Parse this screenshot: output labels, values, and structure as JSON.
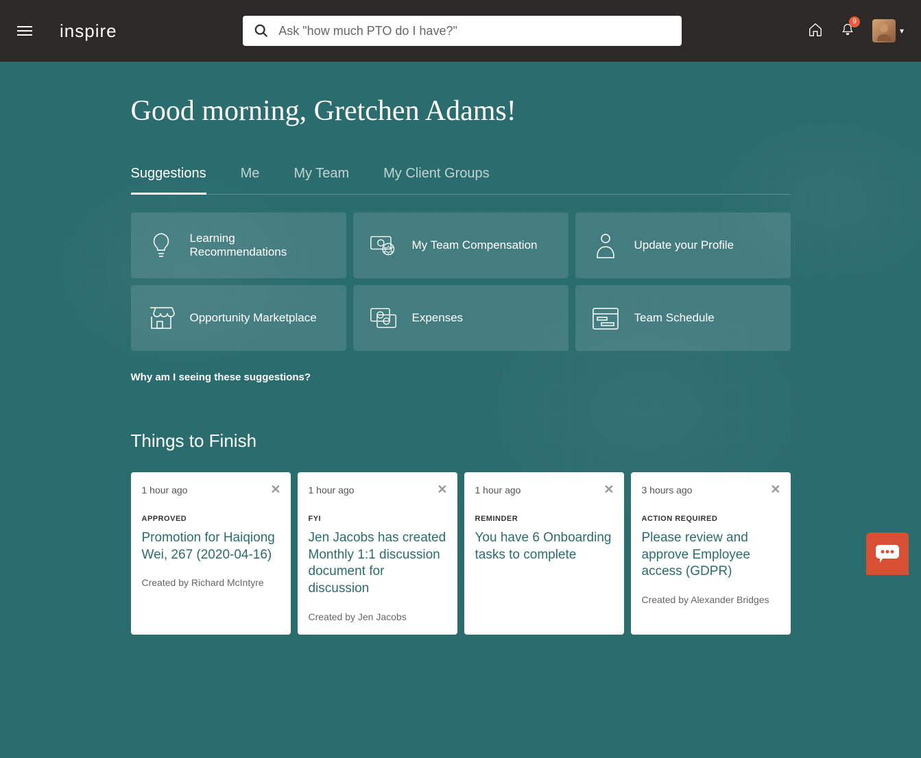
{
  "header": {
    "logo": "inspire",
    "search_placeholder": "Ask \"how much PTO do I have?\"",
    "notification_count": "9"
  },
  "greeting": "Good morning, Gretchen Adams!",
  "tabs": [
    {
      "label": "Suggestions",
      "active": true
    },
    {
      "label": "Me",
      "active": false
    },
    {
      "label": "My Team",
      "active": false
    },
    {
      "label": "My Client Groups",
      "active": false
    }
  ],
  "suggestion_cards": [
    {
      "label": "Learning Recommendations",
      "icon": "lightbulb"
    },
    {
      "label": "My Team Compensation",
      "icon": "compensation"
    },
    {
      "label": "Update your Profile",
      "icon": "profile"
    },
    {
      "label": "Opportunity Marketplace",
      "icon": "marketplace"
    },
    {
      "label": "Expenses",
      "icon": "expenses"
    },
    {
      "label": "Team Schedule",
      "icon": "schedule"
    }
  ],
  "suggestions_link": "Why am I seeing these suggestions?",
  "things_title": "Things to Finish",
  "tasks": [
    {
      "time": "1 hour ago",
      "status": "APPROVED",
      "title": "Promotion for Haiqiong Wei, 267 (2020-04-16)",
      "creator": "Created by Richard McIntyre"
    },
    {
      "time": "1 hour ago",
      "status": "FYI",
      "title": "Jen Jacobs has created Monthly 1:1 discussion document for discussion",
      "creator": "Created by Jen Jacobs"
    },
    {
      "time": "1 hour ago",
      "status": "REMINDER",
      "title": "You have 6 Onboarding tasks to complete",
      "creator": ""
    },
    {
      "time": "3 hours ago",
      "status": "ACTION REQUIRED",
      "title": "Please review and approve Employee access (GDPR)",
      "creator": "Created by Alexander Bridges"
    }
  ]
}
